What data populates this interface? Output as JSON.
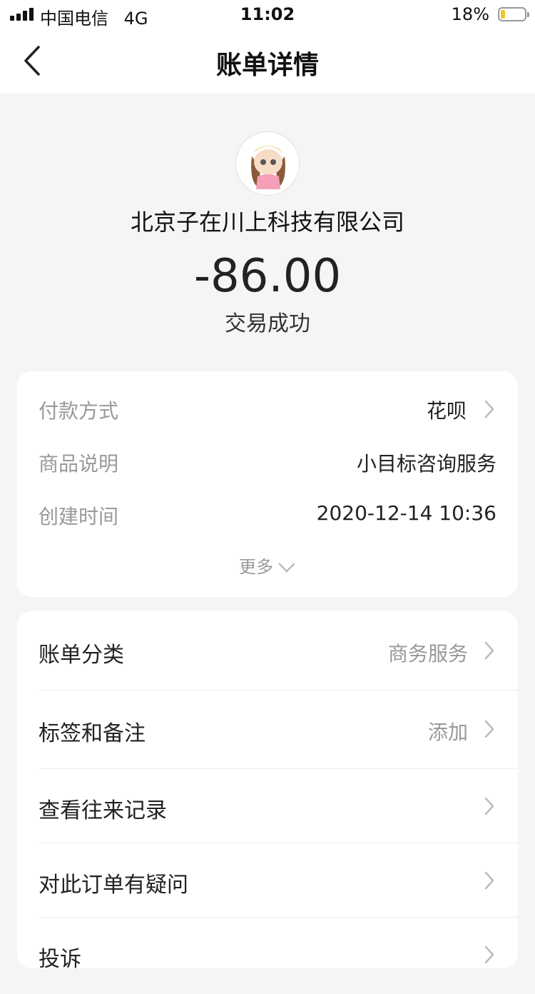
{
  "status_bar": {
    "carrier": "中国电信",
    "network": "4G",
    "time": "11:02",
    "battery": "18%",
    "battery_level": 0.18
  },
  "nav": {
    "title": "账单详情",
    "back_icon": "chevron-left-icon"
  },
  "transaction": {
    "merchant": "北京子在川上科技有限公司",
    "amount": "-86.00",
    "status": "交易成功"
  },
  "details": {
    "payment_method_label": "付款方式",
    "payment_method_value": "花呗",
    "product_label": "商品说明",
    "product_value": "小目标咨询服务",
    "created_label": "创建时间",
    "created_value": "2020-12-14 10:36",
    "more_label": "更多"
  },
  "actions": [
    {
      "label": "账单分类",
      "value": "商务服务"
    },
    {
      "label": "标签和备注",
      "value": "添加"
    },
    {
      "label": "查看往来记录",
      "value": ""
    },
    {
      "label": "对此订单有疑问",
      "value": ""
    },
    {
      "label": "投诉",
      "value": ""
    }
  ],
  "colors": {
    "background": "#f5f5f5",
    "card": "#ffffff",
    "label_gray": "#999999",
    "text_dark": "#222222",
    "battery_fill": "#f4c430"
  }
}
